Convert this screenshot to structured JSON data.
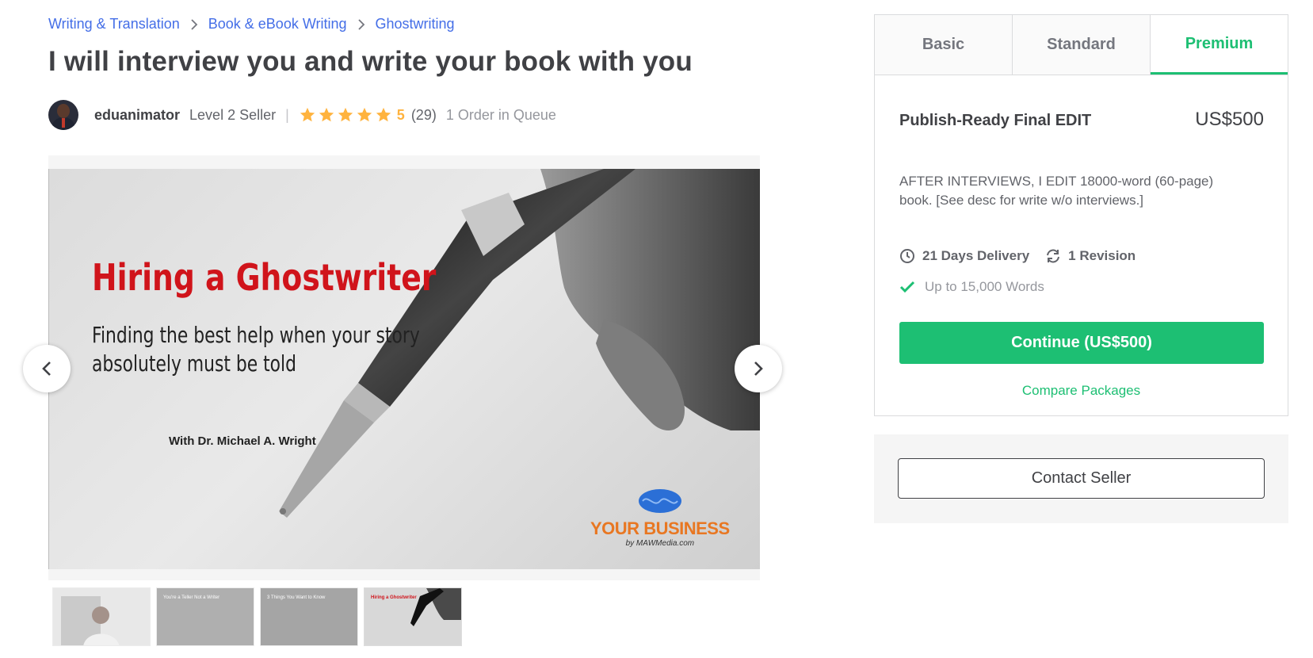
{
  "breadcrumb": [
    "Writing & Translation",
    "Book & eBook Writing",
    "Ghostwriting"
  ],
  "gig": {
    "title": "I will interview you and write your book with you"
  },
  "seller": {
    "username": "eduanimator",
    "level": "Level 2 Seller",
    "divider": "|",
    "rating": "5",
    "star_count": 5,
    "reviews": "(29)",
    "queue": "1 Order in Queue"
  },
  "gallery": {
    "slide_title": "Hiring a Ghostwriter",
    "slide_subtitle_1": "Finding the best help when your story",
    "slide_subtitle_2": "absolutely must be told",
    "slide_author": "With Dr. Michael A. Wright",
    "brand_word_1": "YOUR",
    "brand_word_2": "BUSINESS",
    "brand_by": "by MAWMedia.com",
    "thumbnails": [
      {
        "text": "",
        "bg": "#cfcfcf"
      },
      {
        "text": "You're a Teller Not a Writer",
        "bg": "#6e6e6e"
      },
      {
        "text": "3 Things You Want to Know",
        "bg": "#5d5d5d"
      },
      {
        "text": "Hiring a Ghostwriter",
        "bg": "#d8d8d8"
      }
    ]
  },
  "packages": {
    "tabs": [
      "Basic",
      "Standard",
      "Premium"
    ],
    "active_tab": "Premium",
    "name": "Publish-Ready Final EDIT",
    "price": "US$500",
    "description": "AFTER INTERVIEWS, I EDIT 18000-word (60-page) book. [See desc for write w/o interviews.]",
    "delivery": "21 Days Delivery",
    "revisions": "1 Revision",
    "feature": "Up to 15,000 Words",
    "continue_label": "Continue (US$500)",
    "compare_label": "Compare Packages"
  },
  "contact": {
    "label": "Contact Seller"
  },
  "colors": {
    "accent": "#1dbf73",
    "link": "#446ee7",
    "star": "#ffb33e",
    "slide_title": "#d0141b"
  }
}
